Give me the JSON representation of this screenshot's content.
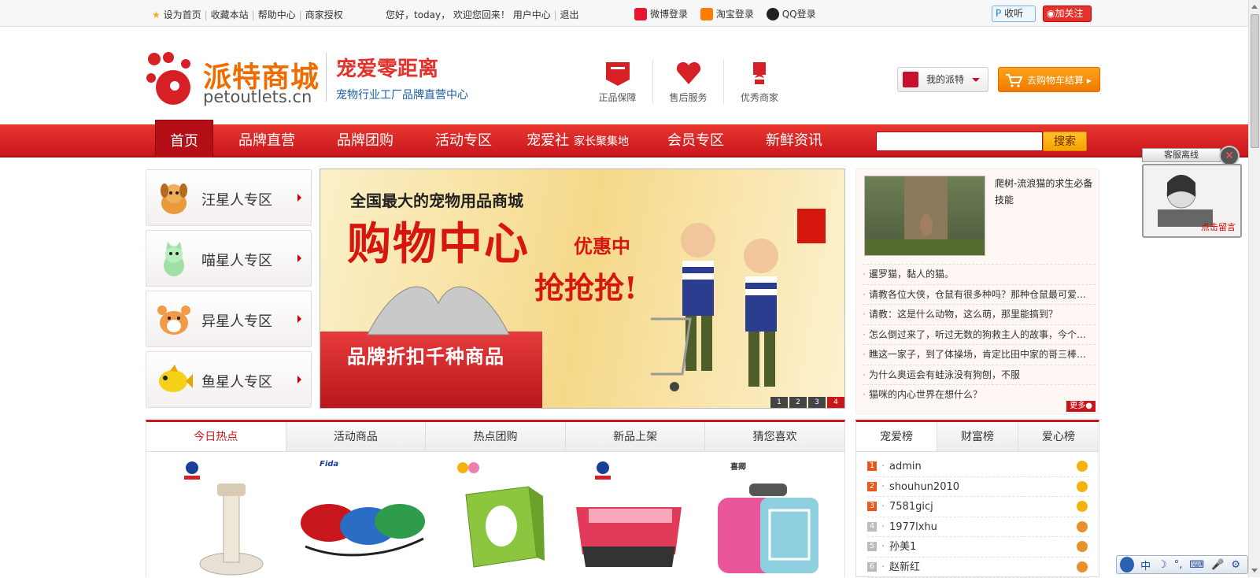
{
  "topbar": {
    "links": [
      "设为首页",
      "收藏本站",
      "帮助中心",
      "商家授权"
    ],
    "greeting": "您好，today，  欢迎您回来！",
    "user_center": "用户中心",
    "logout": "退出",
    "logins": [
      {
        "label": "微博登录",
        "icon": "weibo-icon",
        "color": "#e6162d"
      },
      {
        "label": "淘宝登录",
        "icon": "taobao-icon",
        "color": "#ff7d00"
      },
      {
        "label": "QQ登录",
        "icon": "qq-icon",
        "color": "#222222"
      }
    ],
    "listen": "收听",
    "follow": "加关注"
  },
  "header": {
    "logo_cn": "派特商城",
    "logo_en": "petoutlets.cn",
    "slogan_main": "宠爱零距离",
    "slogan_sub": "宠物行业工厂品牌直营中心",
    "services": [
      {
        "label": "正品保障",
        "icon": "badge-icon"
      },
      {
        "label": "售后服务",
        "icon": "heart-icon"
      },
      {
        "label": "优秀商家",
        "icon": "medal-icon"
      }
    ],
    "my_account": "我的派特",
    "cart": "去购物车结算"
  },
  "nav": {
    "items": [
      "首页",
      "品牌直营",
      "品牌团购",
      "活动专区",
      "宠爱社",
      "会员专区",
      "新鲜资讯"
    ],
    "item_sub": "家长聚集地",
    "search_placeholder": "",
    "search_button": "搜索"
  },
  "categories": [
    {
      "label": "汪星人专区",
      "icon": "dog-icon"
    },
    {
      "label": "喵星人专区",
      "icon": "cat-icon"
    },
    {
      "label": "异星人专区",
      "icon": "hamster-icon"
    },
    {
      "label": "鱼星人专区",
      "icon": "fish-icon"
    }
  ],
  "banner": {
    "line1": "全国最大的宠物用品商城",
    "line2": "购物中心",
    "line3": "优惠中",
    "line4": "抢抢抢!",
    "gift_label": "品牌折扣千种商品",
    "pages": [
      "1",
      "2",
      "3",
      "4"
    ],
    "active_page": 4
  },
  "news": {
    "feature_title": "爬树-流浪猫的求生必备技能",
    "items": [
      "暹罗猫，黏人的猫。",
      "请教各位大侠，仓鼠有很多种吗？那种仓鼠最可爱…",
      "请教：这是什么动物，这么萌，那里能搞到？",
      "怎么倒过来了，听过无数的狗救主人的故事，今个…",
      "瞧这一家子，到了体操场，肯定比田中家的哥三棒…",
      "为什么奥运会有蛙泳没有狗刨，不服",
      "猫咪的内心世界在想什么？"
    ],
    "more": "更多●"
  },
  "product_tabs": {
    "tabs": [
      "今日热点",
      "活动商品",
      "热点团购",
      "新品上架",
      "猜您喜欢"
    ],
    "active": 0,
    "products": [
      {
        "brand": "",
        "icon": "feeder-product"
      },
      {
        "brand": "Fida",
        "icon": "leash-product"
      },
      {
        "brand": "",
        "icon": "litter-box-product"
      },
      {
        "brand": "",
        "icon": "litter-tray-product"
      },
      {
        "brand": "喜卿",
        "icon": "pet-carrier-product"
      }
    ]
  },
  "ranking": {
    "tabs": [
      "宠爱榜",
      "财富榜",
      "爱心榜"
    ],
    "active": 0,
    "users": [
      {
        "rank": "1",
        "name": "admin"
      },
      {
        "rank": "2",
        "name": "shouhun2010"
      },
      {
        "rank": "3",
        "name": "7581gicj"
      },
      {
        "rank": "4",
        "name": "1977lxhu"
      },
      {
        "rank": "5",
        "name": "孙美1"
      },
      {
        "rank": "6",
        "name": "赵新红"
      }
    ]
  },
  "customer_service": {
    "status": "客服离线",
    "leave_message": "点击留言"
  },
  "ime": {
    "items": [
      "中",
      "☽",
      "°,",
      "⌨",
      "🎤",
      "⚙"
    ]
  }
}
